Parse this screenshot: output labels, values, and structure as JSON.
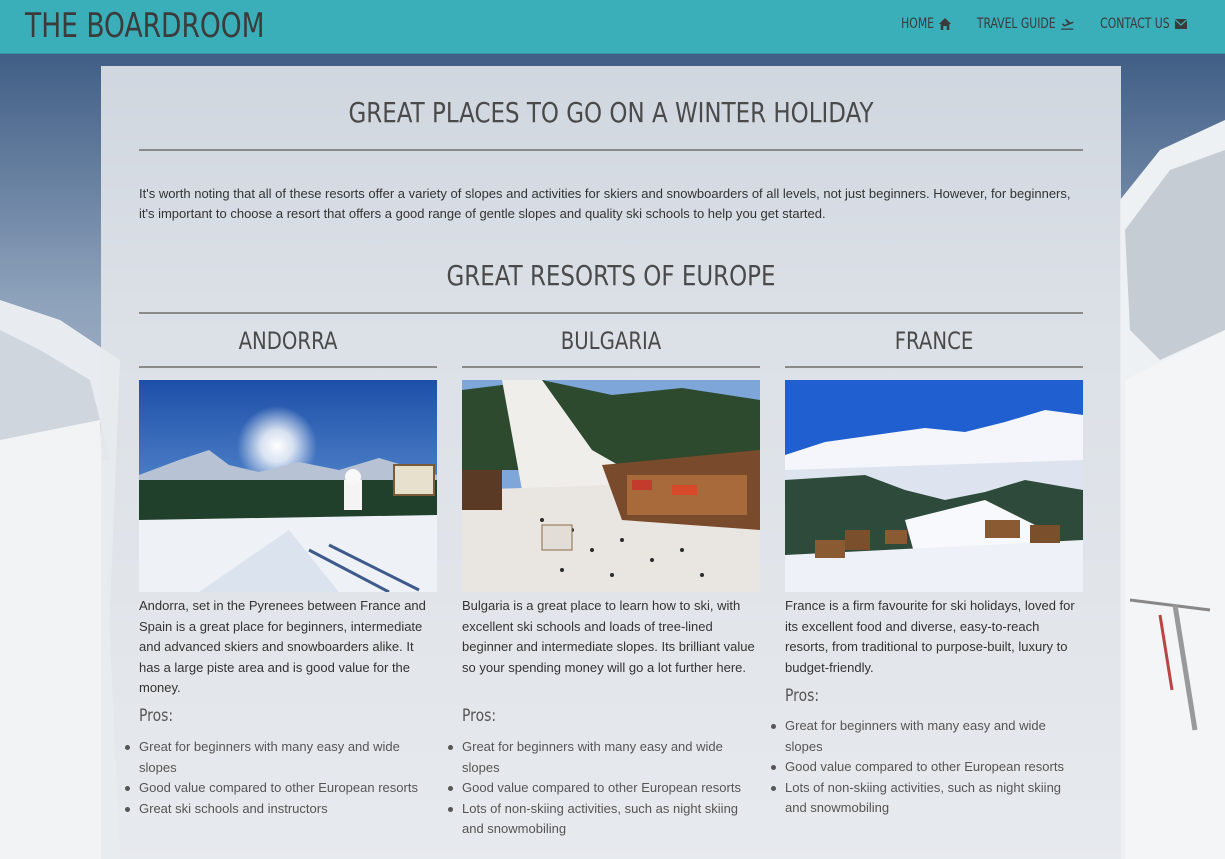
{
  "navbar": {
    "brand": "THE BOARDROOM",
    "links": [
      {
        "label": "HOME",
        "icon": "home-icon"
      },
      {
        "label": "TRAVEL GUIDE",
        "icon": "plane-icon"
      },
      {
        "label": "CONTACT US",
        "icon": "envelope-icon"
      }
    ]
  },
  "main": {
    "title": "GREAT PLACES TO GO ON A WINTER HOLIDAY",
    "intro": "It's worth noting that all of these resorts offer a variety of slopes and activities for skiers and snowboarders of all levels, not just beginners. However, for beginners, it's important to choose a resort that offers a good range of gentle slopes and quality ski schools to help you get started.",
    "subtitle": "GREAT RESORTS OF EUROPE",
    "pros_label": "Pros:",
    "resorts": [
      {
        "name": "ANDORRA",
        "description": "Andorra, set in the Pyrenees between France and Spain is a great place for beginners, intermediate and advanced skiers and snowboarders alike. It has a large piste area and is good value for the money.",
        "pros": [
          "Great for beginners with many easy and wide slopes",
          "Good value compared to other European resorts",
          "Great ski schools and instructors"
        ]
      },
      {
        "name": "BULGARIA",
        "description": "Bulgaria is a great place to learn how to ski, with excellent ski schools and loads of tree-lined beginner and intermediate slopes. Its brilliant value so your spending money will go a lot further here.",
        "pros": [
          "Great for beginners with many easy and wide slopes",
          "Good value compared to other European resorts",
          "Lots of non-skiing activities, such as night skiing and snowmobiling"
        ]
      },
      {
        "name": "FRANCE",
        "description": "France is a firm favourite for ski holidays, loved for its excellent food and diverse, easy-to-reach resorts, from traditional to purpose-built, luxury to budget-friendly.",
        "pros": [
          "Great for beginners with many easy and wide slopes",
          "Good value compared to other European resorts",
          "Lots of non-skiing activities, such as night skiing and snowmobiling"
        ]
      }
    ]
  },
  "colors": {
    "navbar": "#3aaeb9",
    "text": "#333333",
    "heading": "#4a4a4a"
  }
}
